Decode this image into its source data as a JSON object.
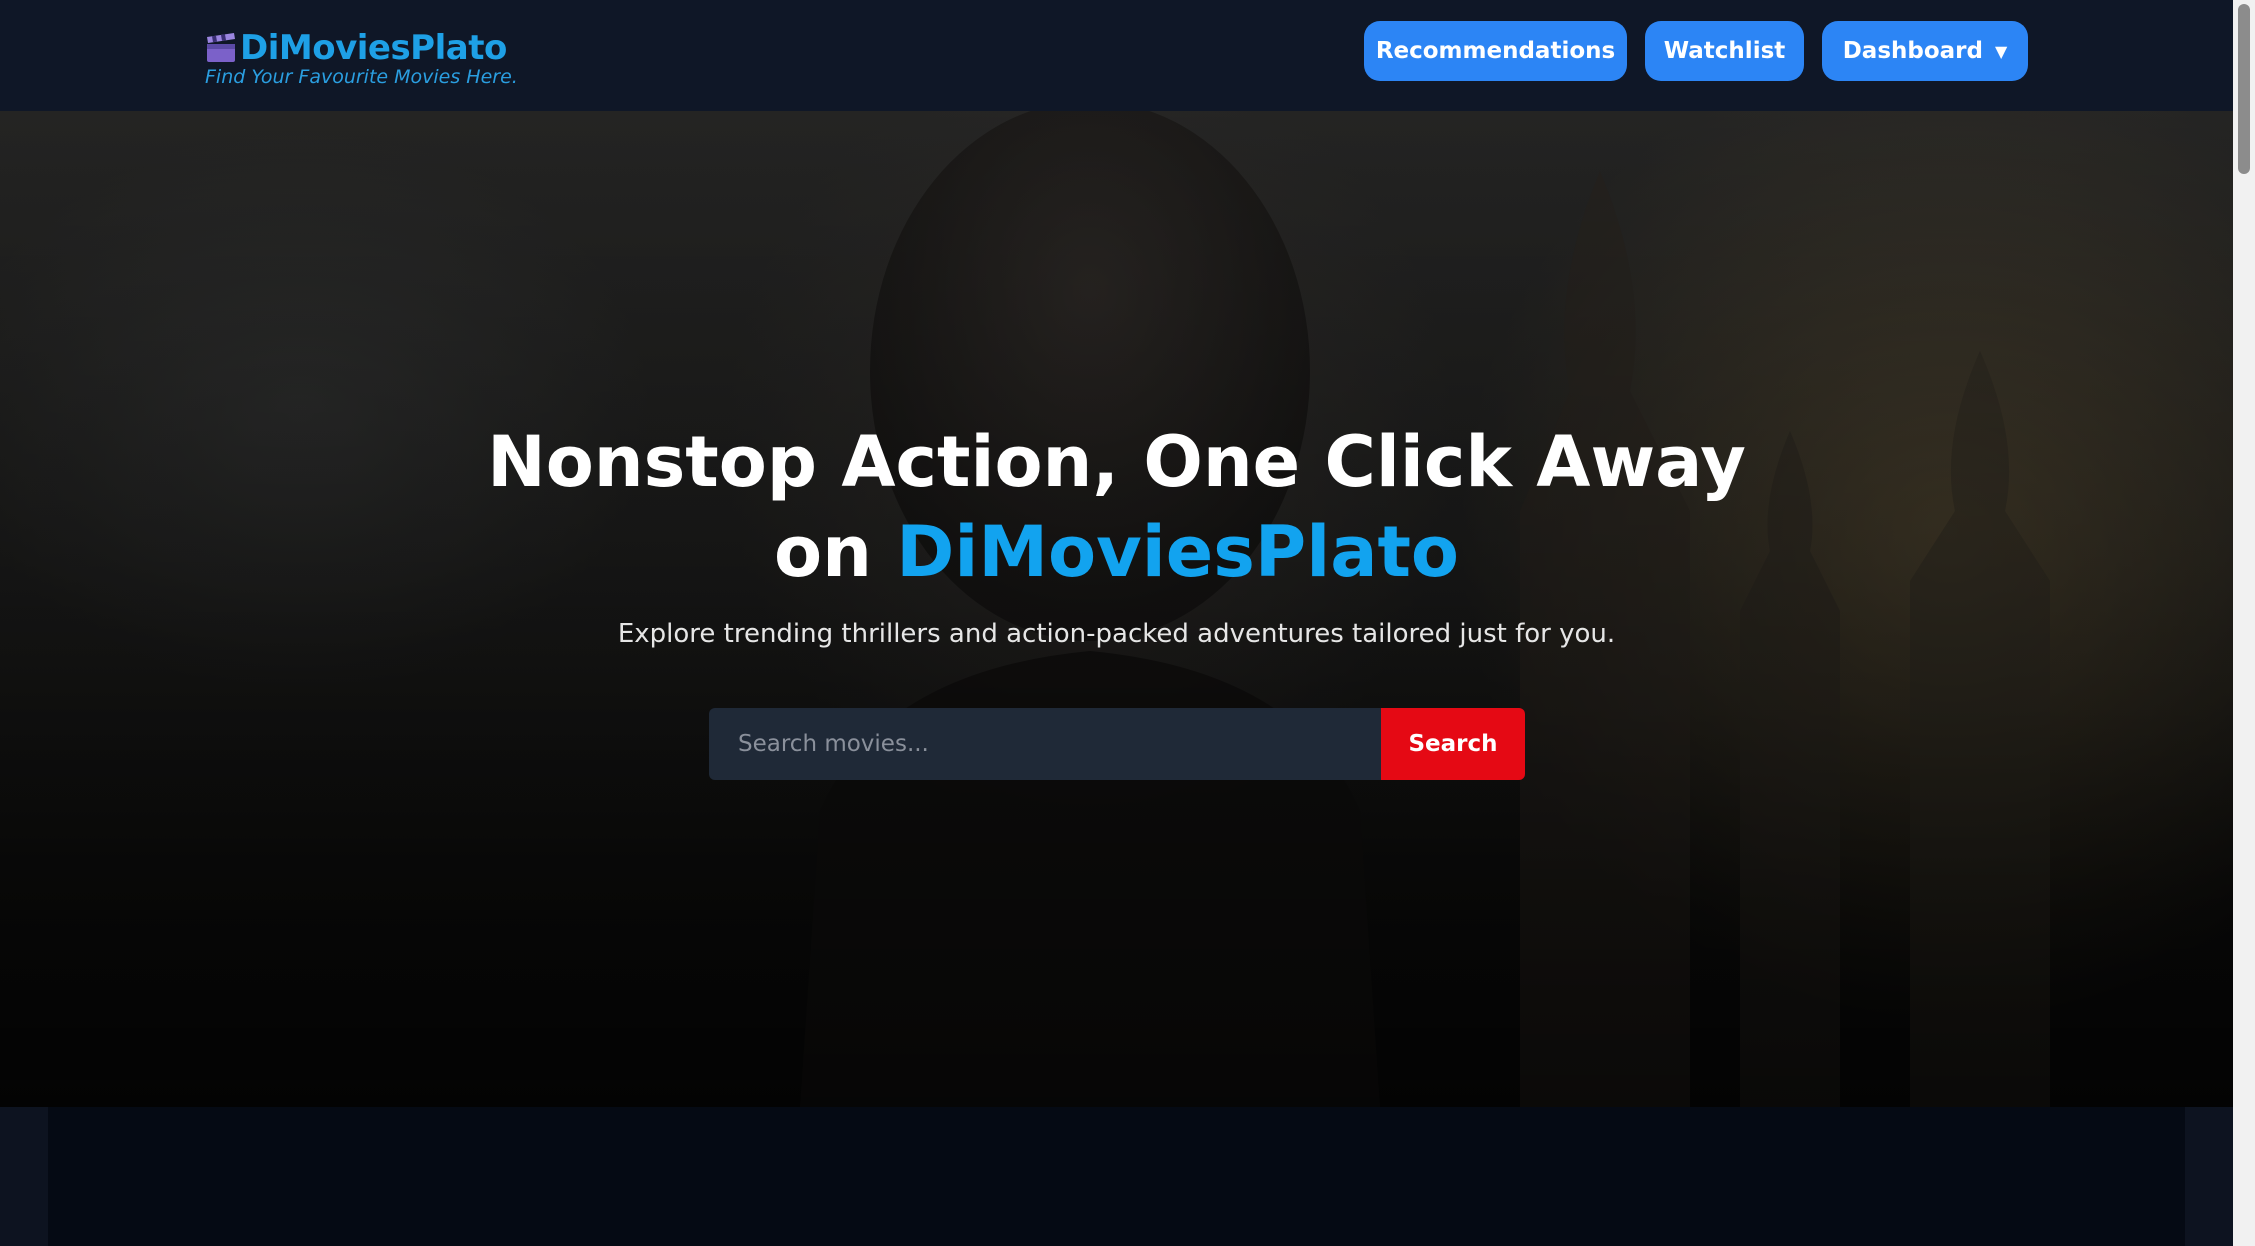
{
  "brand": {
    "title": "DiMoviesPlato",
    "tagline": "Find Your Favourite Movies Here.",
    "logo_icon": "clapperboard-icon"
  },
  "nav": {
    "recommendations_label": "Recommendations",
    "watchlist_label": "Watchlist",
    "dashboard_label": "Dashboard",
    "dashboard_caret": "▼"
  },
  "hero": {
    "title_line1": "Nonstop Action, One Click Away",
    "title_line2_prefix": "on ",
    "title_line2_accent": "DiMoviesPlato",
    "subtitle": "Explore trending thrillers and action-packed adventures tailored just for you."
  },
  "search": {
    "placeholder": "Search movies...",
    "value": "",
    "button_label": "Search"
  },
  "colors": {
    "accent_blue": "#12a3ef",
    "nav_button_blue": "#2c85f5",
    "search_red": "#e50914",
    "navbar_bg": "#0f1727"
  }
}
